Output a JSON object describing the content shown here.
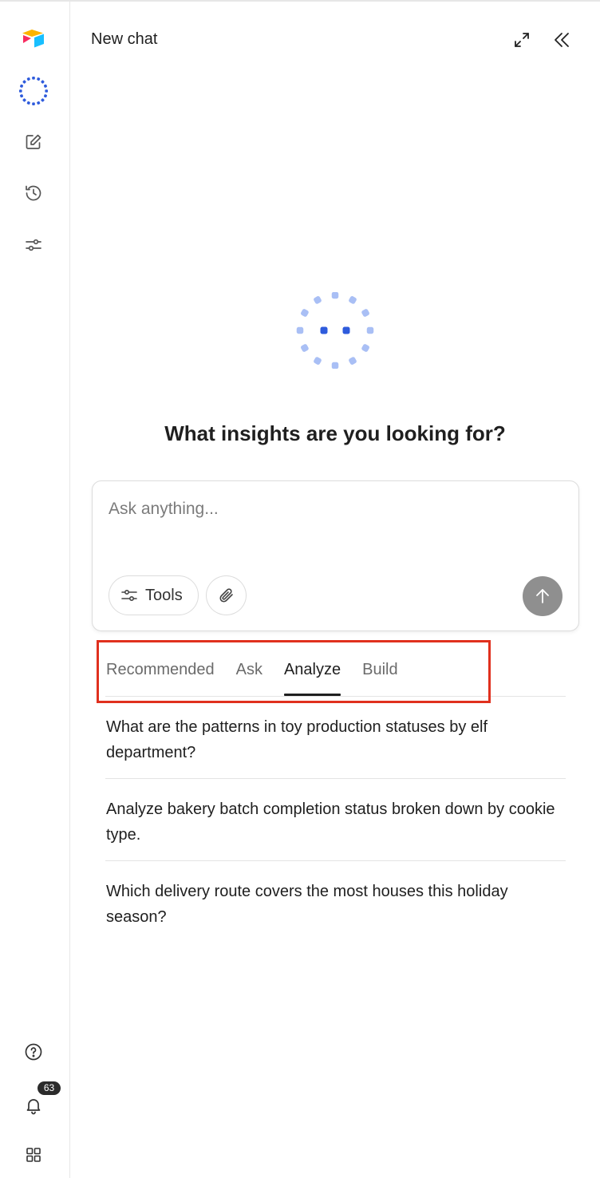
{
  "header": {
    "title": "New chat"
  },
  "hero": {
    "heading": "What insights are you looking for?"
  },
  "composer": {
    "placeholder": "Ask anything...",
    "tools_label": "Tools"
  },
  "tabs": [
    {
      "label": "Recommended",
      "active": false
    },
    {
      "label": "Ask",
      "active": false
    },
    {
      "label": "Analyze",
      "active": true
    },
    {
      "label": "Build",
      "active": false
    }
  ],
  "suggestions": [
    "What are the patterns in toy production statuses by elf department?",
    "Analyze bakery batch completion status broken down by cookie type.",
    "Which delivery route covers the most houses this holiday season?"
  ],
  "notifications": {
    "count": "63"
  },
  "colors": {
    "accent": "#2e5bdc",
    "highlight": "#e0301e",
    "send_button": "#8f8f8f"
  },
  "icons": {
    "rail": [
      "airtable-logo",
      "ai-spinner-icon",
      "edit-icon",
      "history-icon",
      "sliders-icon",
      "help-icon",
      "bell-icon",
      "apps-grid-icon"
    ],
    "header": [
      "expand-icon",
      "collapse-panel-icon"
    ]
  }
}
